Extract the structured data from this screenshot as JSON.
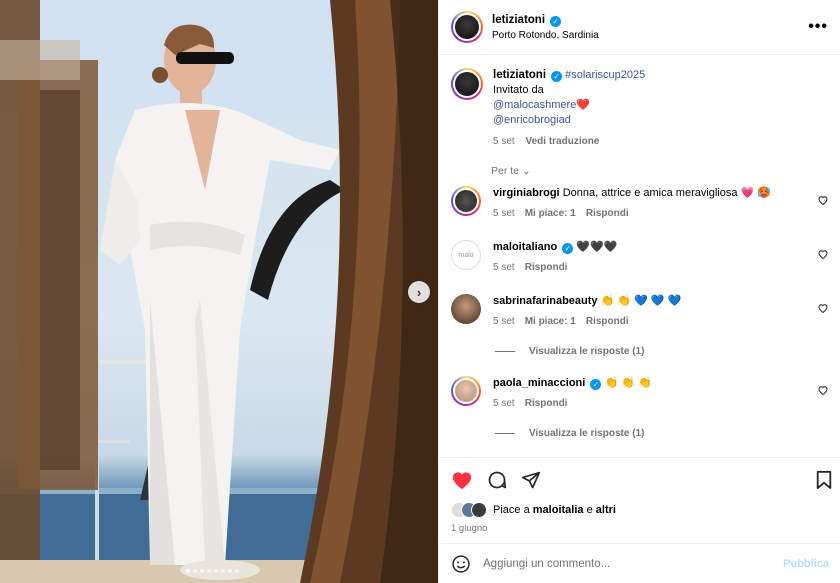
{
  "post": {
    "username": "letiziatoni",
    "location": "Porto Rotondo, Sardinia",
    "verified_mark": "✓",
    "more_glyph": "•••",
    "next_glyph": "›",
    "carousel_count": 8,
    "carousel_active": 0
  },
  "caption": {
    "username": "letiziatoni",
    "hashtag": "#solariscup2025",
    "line2": "Invitato da",
    "mention1": "@malocashmere",
    "mention1_emoji": "❤️",
    "mention2": "@enricobrogiad",
    "date": "5 set",
    "translate": "Vedi traduzione"
  },
  "for_you": "Per te",
  "comments": [
    {
      "username": "virginiabrogi",
      "text": "Donna, attrice e amica meravigliosa 💗 🥵",
      "date": "5 set",
      "likes": "Mi piace: 1",
      "reply": "Rispondi"
    },
    {
      "username": "maloitaliano",
      "text": "🖤🖤🖤",
      "date": "5 set",
      "likes": "",
      "reply": "Rispondi"
    },
    {
      "username": "sabrinafarinabeauty",
      "text": "👏 👏 💙 💙 💙",
      "date": "5 set",
      "likes": "Mi piace: 1",
      "reply": "Rispondi"
    },
    {
      "username": "paola_minaccioni",
      "text": "👏 👏 👏",
      "date": "5 set",
      "likes": "",
      "reply": "Rispondi"
    }
  ],
  "view_replies": "Visualizza le risposte (1)",
  "likes": {
    "prefix": "Piace a",
    "user": "maloitalia",
    "and": "e",
    "others": "altri"
  },
  "post_date": "1 giugno",
  "add_comment": {
    "placeholder": "Aggiungi un commento...",
    "post_label": "Pubblica"
  },
  "colors": {
    "like_red": "#ff3040",
    "link_blue": "#385898",
    "verified_blue": "#0095f6",
    "muted": "#737373"
  }
}
